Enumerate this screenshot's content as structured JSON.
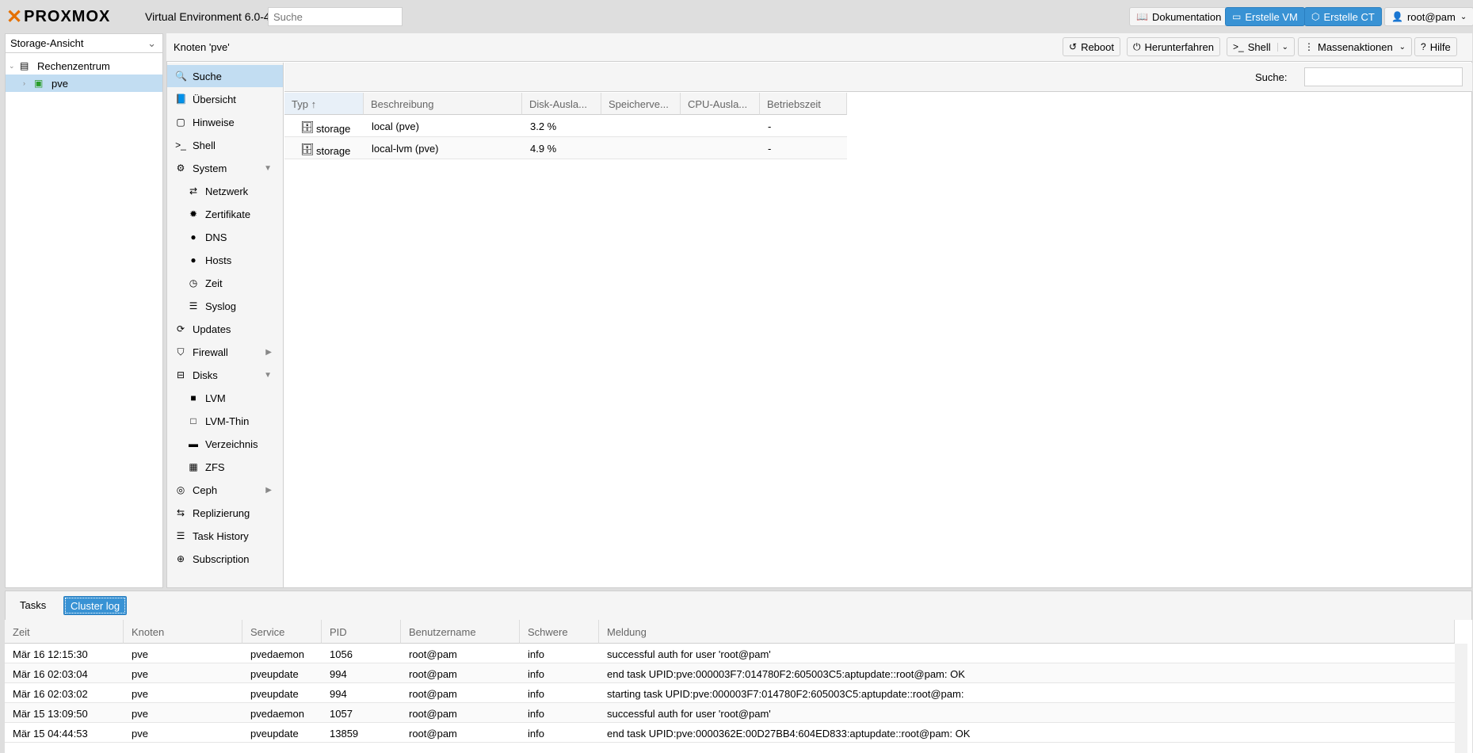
{
  "header": {
    "logo_text": "PROXMOX",
    "version": "Virtual Environment 6.0-4",
    "search_placeholder": "Suche",
    "btn_docs": "Dokumentation",
    "btn_create_vm": "Erstelle VM",
    "btn_create_ct": "Erstelle CT",
    "user": "root@pam"
  },
  "tree": {
    "view": "Storage-Ansicht",
    "items": [
      {
        "label": "Rechenzentrum"
      },
      {
        "label": "pve"
      }
    ]
  },
  "node_toolbar": {
    "title": "Knoten 'pve'",
    "reboot": "Reboot",
    "shutdown": "Herunterfahren",
    "shell": "Shell",
    "bulk": "Massenaktionen",
    "help": "Hilfe"
  },
  "nav": {
    "items": [
      {
        "label": "Suche"
      },
      {
        "label": "Übersicht"
      },
      {
        "label": "Hinweise"
      },
      {
        "label": "Shell"
      },
      {
        "label": "System"
      },
      {
        "label": "Netzwerk"
      },
      {
        "label": "Zertifikate"
      },
      {
        "label": "DNS"
      },
      {
        "label": "Hosts"
      },
      {
        "label": "Zeit"
      },
      {
        "label": "Syslog"
      },
      {
        "label": "Updates"
      },
      {
        "label": "Firewall"
      },
      {
        "label": "Disks"
      },
      {
        "label": "LVM"
      },
      {
        "label": "LVM-Thin"
      },
      {
        "label": "Verzeichnis"
      },
      {
        "label": "ZFS"
      },
      {
        "label": "Ceph"
      },
      {
        "label": "Replizierung"
      },
      {
        "label": "Task History"
      },
      {
        "label": "Subscription"
      }
    ]
  },
  "search_panel": {
    "label": "Suche:",
    "columns": [
      "Typ ↑",
      "Beschreibung",
      "Disk-Ausla...",
      "Speicherve...",
      "CPU-Ausla...",
      "Betriebszeit"
    ],
    "rows": [
      {
        "type": "storage",
        "desc": "local (pve)",
        "disk": "3.2 %",
        "mem": "",
        "cpu": "",
        "uptime": "-"
      },
      {
        "type": "storage",
        "desc": "local-lvm (pve)",
        "disk": "4.9 %",
        "mem": "",
        "cpu": "",
        "uptime": "-"
      }
    ]
  },
  "bottom": {
    "tab_tasks": "Tasks",
    "tab_cluster": "Cluster log",
    "columns": [
      "Zeit",
      "Knoten",
      "Service",
      "PID",
      "Benutzername",
      "Schwere",
      "Meldung"
    ],
    "rows": [
      {
        "time": "Mär 16 12:15:30",
        "node": "pve",
        "service": "pvedaemon",
        "pid": "1056",
        "user": "root@pam",
        "sev": "info",
        "msg": "successful auth for user 'root@pam'"
      },
      {
        "time": "Mär 16 02:03:04",
        "node": "pve",
        "service": "pveupdate",
        "pid": "994",
        "user": "root@pam",
        "sev": "info",
        "msg": "end task UPID:pve:000003F7:014780F2:605003C5:aptupdate::root@pam: OK"
      },
      {
        "time": "Mär 16 02:03:02",
        "node": "pve",
        "service": "pveupdate",
        "pid": "994",
        "user": "root@pam",
        "sev": "info",
        "msg": "starting task UPID:pve:000003F7:014780F2:605003C5:aptupdate::root@pam:"
      },
      {
        "time": "Mär 15 13:09:50",
        "node": "pve",
        "service": "pvedaemon",
        "pid": "1057",
        "user": "root@pam",
        "sev": "info",
        "msg": "successful auth for user 'root@pam'"
      },
      {
        "time": "Mär 15 04:44:53",
        "node": "pve",
        "service": "pveupdate",
        "pid": "13859",
        "user": "root@pam",
        "sev": "info",
        "msg": "end task UPID:pve:0000362E:00D27BB4:604ED833:aptupdate::root@pam: OK"
      }
    ]
  }
}
